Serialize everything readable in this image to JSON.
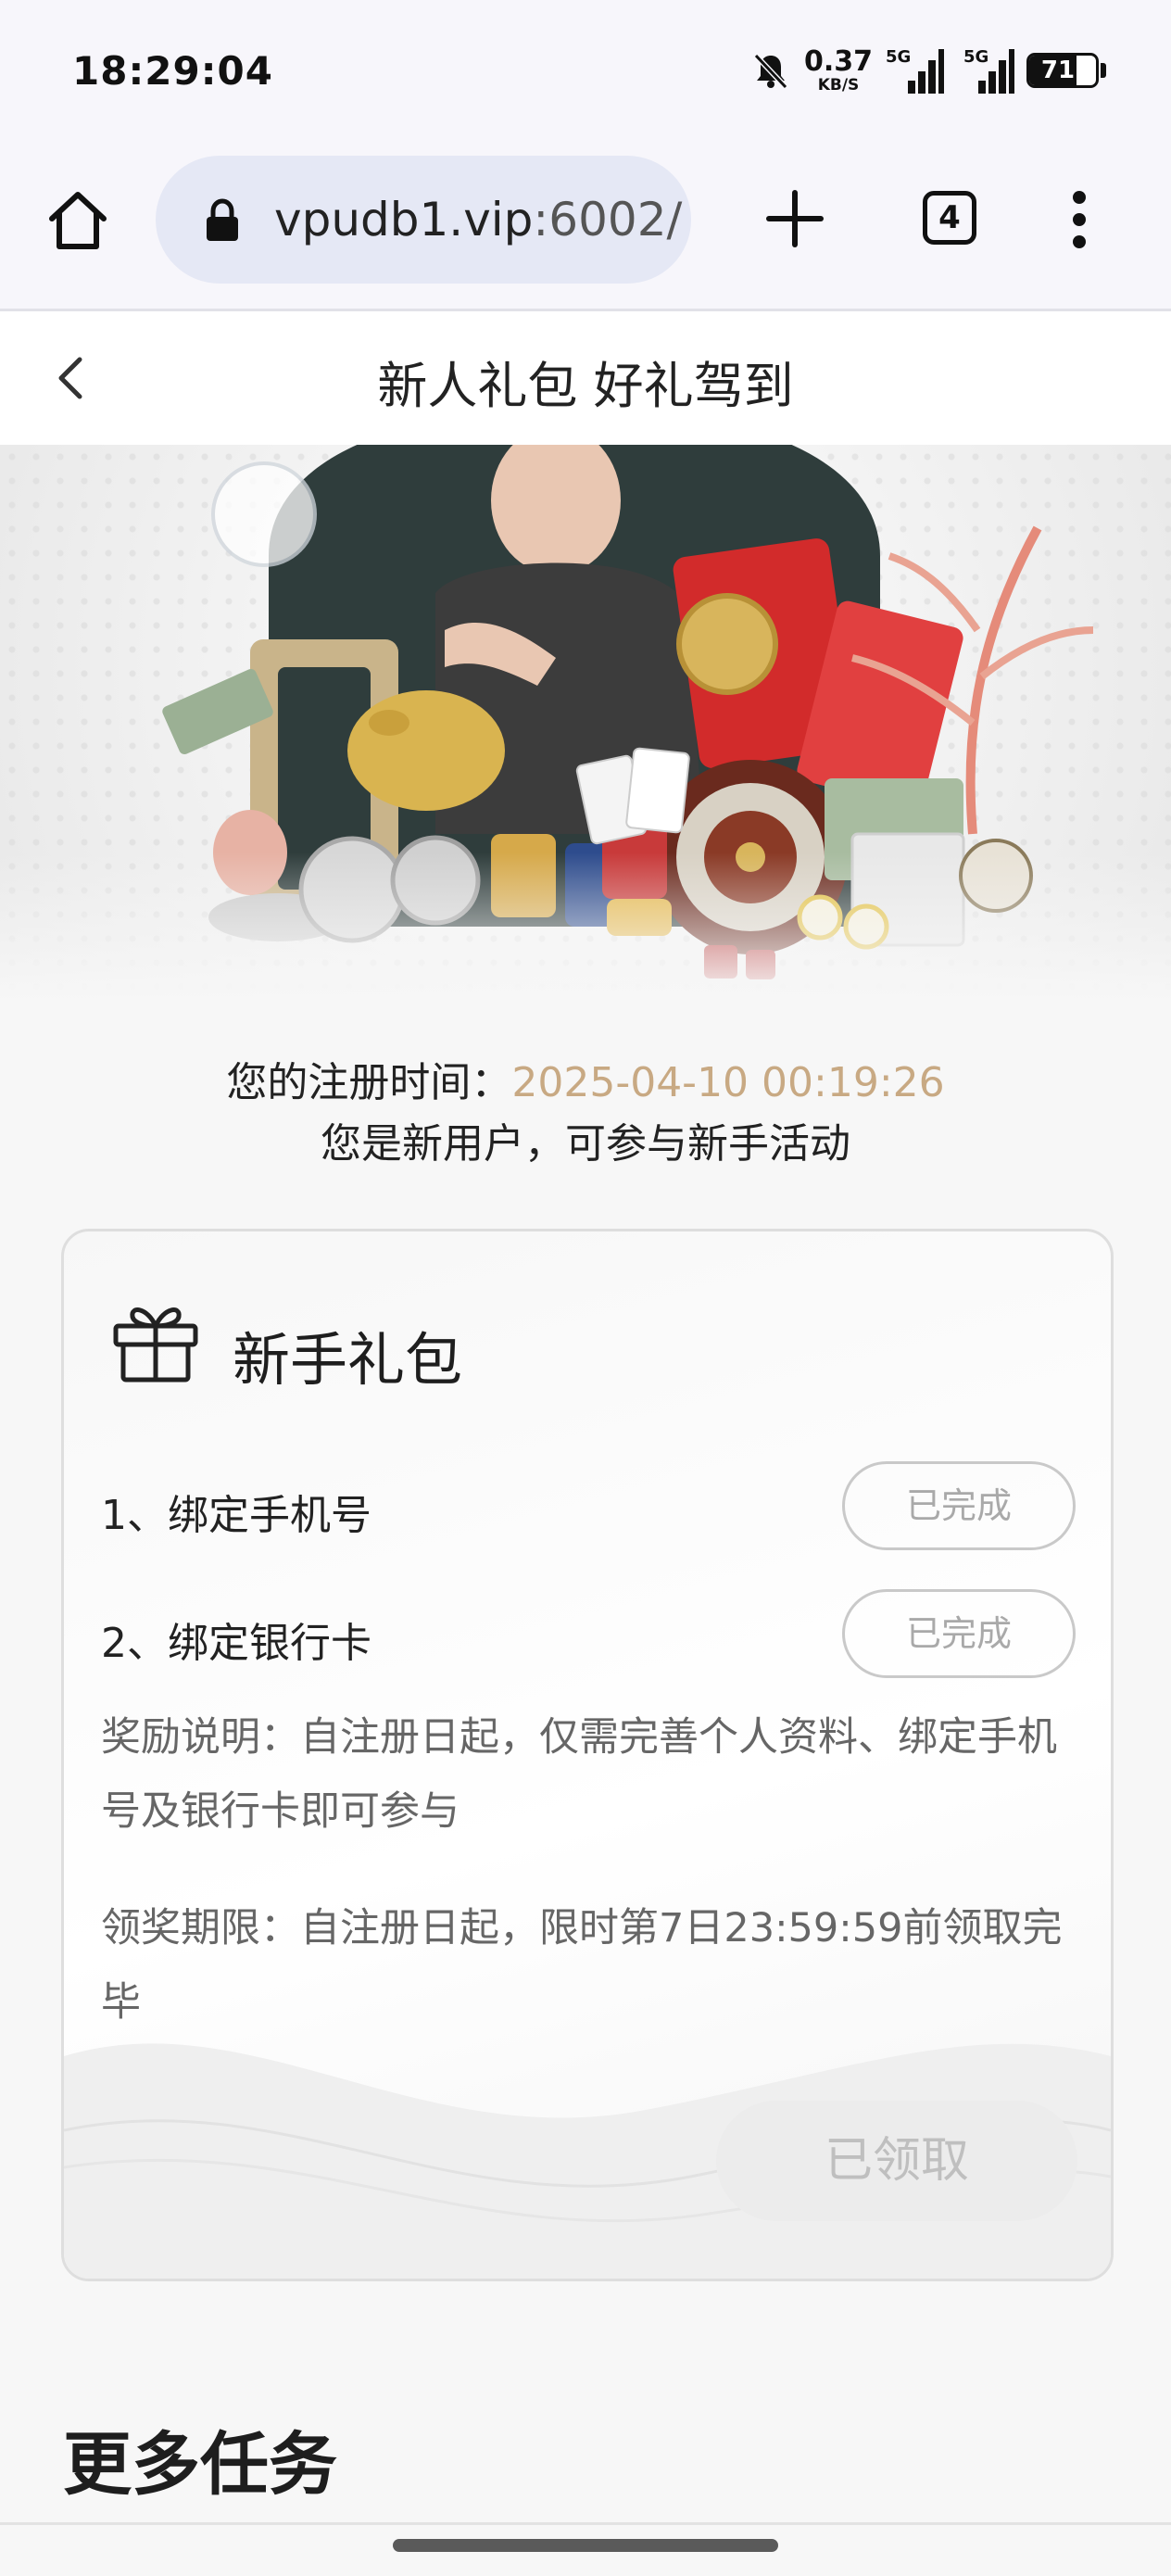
{
  "status_bar": {
    "time": "18:29:04",
    "net_speed_value": "0.37",
    "net_speed_unit": "KB/S",
    "signal_1_label": "5G",
    "signal_2_label": "5G",
    "battery_level": "71",
    "icons": [
      "bell-muted-icon",
      "signal-icon",
      "battery-icon"
    ]
  },
  "browser": {
    "url_host": "vpudb1.vip",
    "url_port": ":6002/",
    "tab_count": "4",
    "icons": [
      "home-icon",
      "lock-icon",
      "plus-icon",
      "tabs-icon",
      "more-vert-icon"
    ]
  },
  "header": {
    "title": "新人礼包 好礼驾到",
    "back_icon": "chevron-left-icon"
  },
  "registration": {
    "label": "您的注册时间：",
    "date": "2025-04-10 00:19:26",
    "message": "您是新用户，可参与新手活动"
  },
  "gift_card": {
    "title": "新手礼包",
    "icon": "gift-icon",
    "tasks": [
      {
        "label": "1、绑定手机号",
        "status": "已完成"
      },
      {
        "label": "2、绑定银行卡",
        "status": "已完成"
      }
    ],
    "reward_note": "奖励说明：自注册日起，仅需完善个人资料、绑定手机号及银行卡即可参与",
    "deadline_note": "领奖期限：自注册日起，限时第7日23:59:59前领取完毕",
    "claim_label": "已领取"
  },
  "more_tasks": {
    "title": "更多任务"
  },
  "colors": {
    "accent_gold": "#c8a983",
    "pill_border": "#c9c9c9",
    "url_pill": "#e5e8f5"
  }
}
